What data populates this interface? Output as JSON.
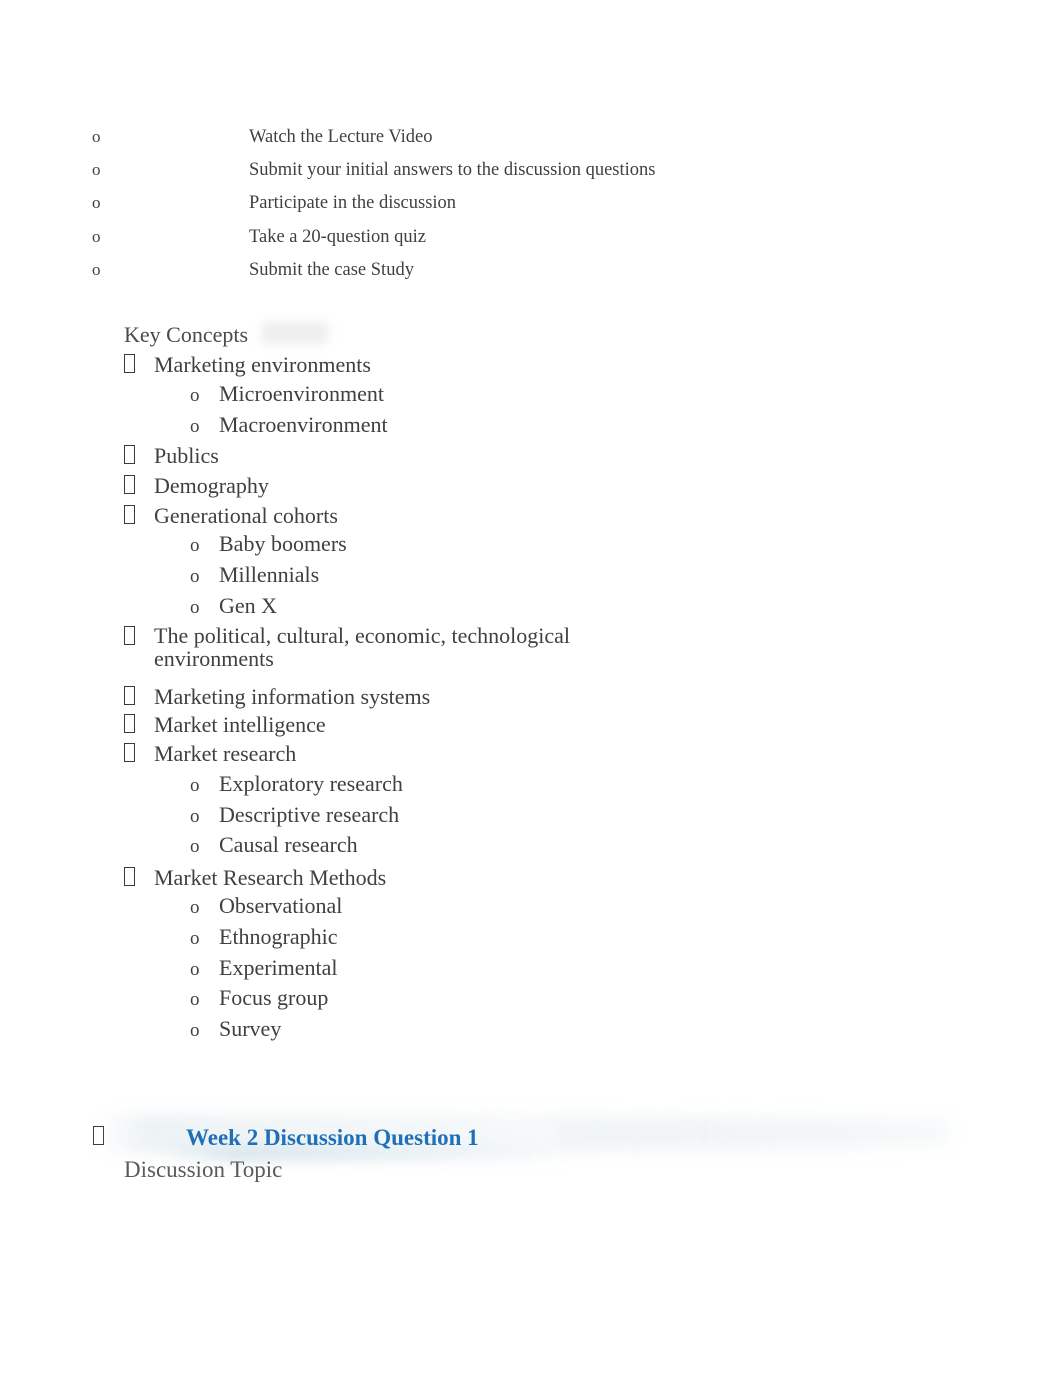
{
  "document": {
    "task_list": {
      "marker": "o",
      "items": [
        "Watch the Lecture Video",
        "Submit your initial answers to the discussion questions",
        "Participate in the discussion",
        "Take a 20-question quiz",
        "Submit the case Study"
      ]
    },
    "key_concepts": {
      "heading": "Key Concepts",
      "bullet_marker": "missing-glyph-box",
      "sub_marker": "o",
      "items": [
        {
          "label": "Marketing environments",
          "children": [
            "Microenvironment",
            "Macroenvironment"
          ]
        },
        {
          "label": "Publics",
          "children": []
        },
        {
          "label": "Demography",
          "children": []
        },
        {
          "label": "Generational cohorts",
          "children": [
            "Baby boomers",
            "Millennials",
            "Gen X"
          ]
        },
        {
          "label": "The political, cultural, economic, technological",
          "label_continued": "environments",
          "children": []
        },
        {
          "label": "Marketing information systems",
          "children": []
        },
        {
          "label": "Market intelligence",
          "children": []
        },
        {
          "label": "Market research",
          "children": [
            "Exploratory research",
            "Descriptive research",
            "Causal research"
          ]
        },
        {
          "label": "Market Research Methods",
          "children": [
            "Observational",
            "Ethnographic",
            "Experimental",
            "Focus group",
            "Survey"
          ]
        }
      ]
    },
    "discussion_section": {
      "heading": "Week 2 Discussion Question 1",
      "heading_color": "#1f70b8",
      "topic_label": "Discussion Topic",
      "topic_color": "#5a5a5a"
    }
  }
}
